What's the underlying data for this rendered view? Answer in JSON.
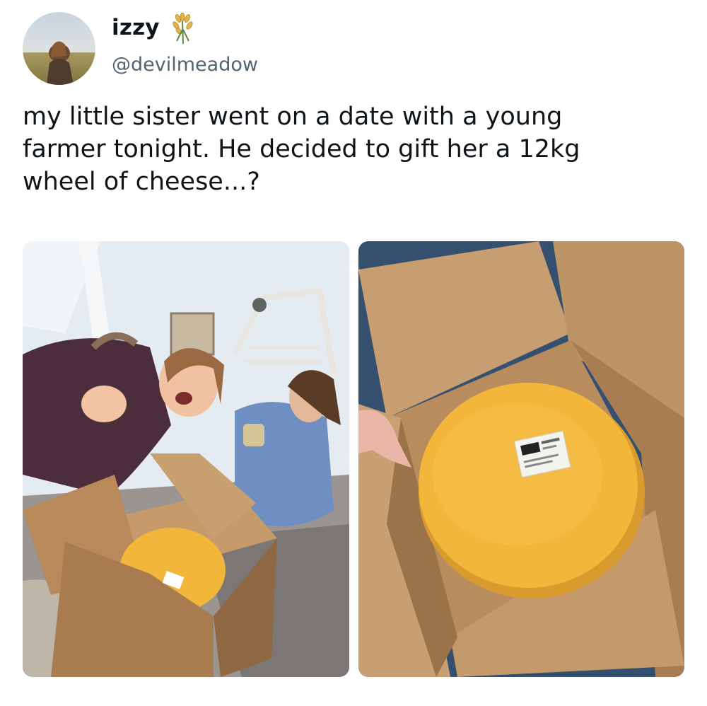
{
  "author": {
    "display_name": "izzy",
    "badge_icon": "wheat-icon",
    "handle": "@devilmeadow"
  },
  "tweet": {
    "lines": [
      "my little sister went on a date with a young",
      "farmer tonight. He decided to gift her a 12kg",
      "wheel of cheese...?"
    ]
  },
  "media": {
    "photos": [
      "photo-girls-with-cheese-box",
      "photo-cheese-wheel-in-box"
    ]
  },
  "colors": {
    "text": "#0f1419",
    "secondary_text": "#536471",
    "cheese": "#f2b73a",
    "cardboard": "#b98c5e"
  }
}
